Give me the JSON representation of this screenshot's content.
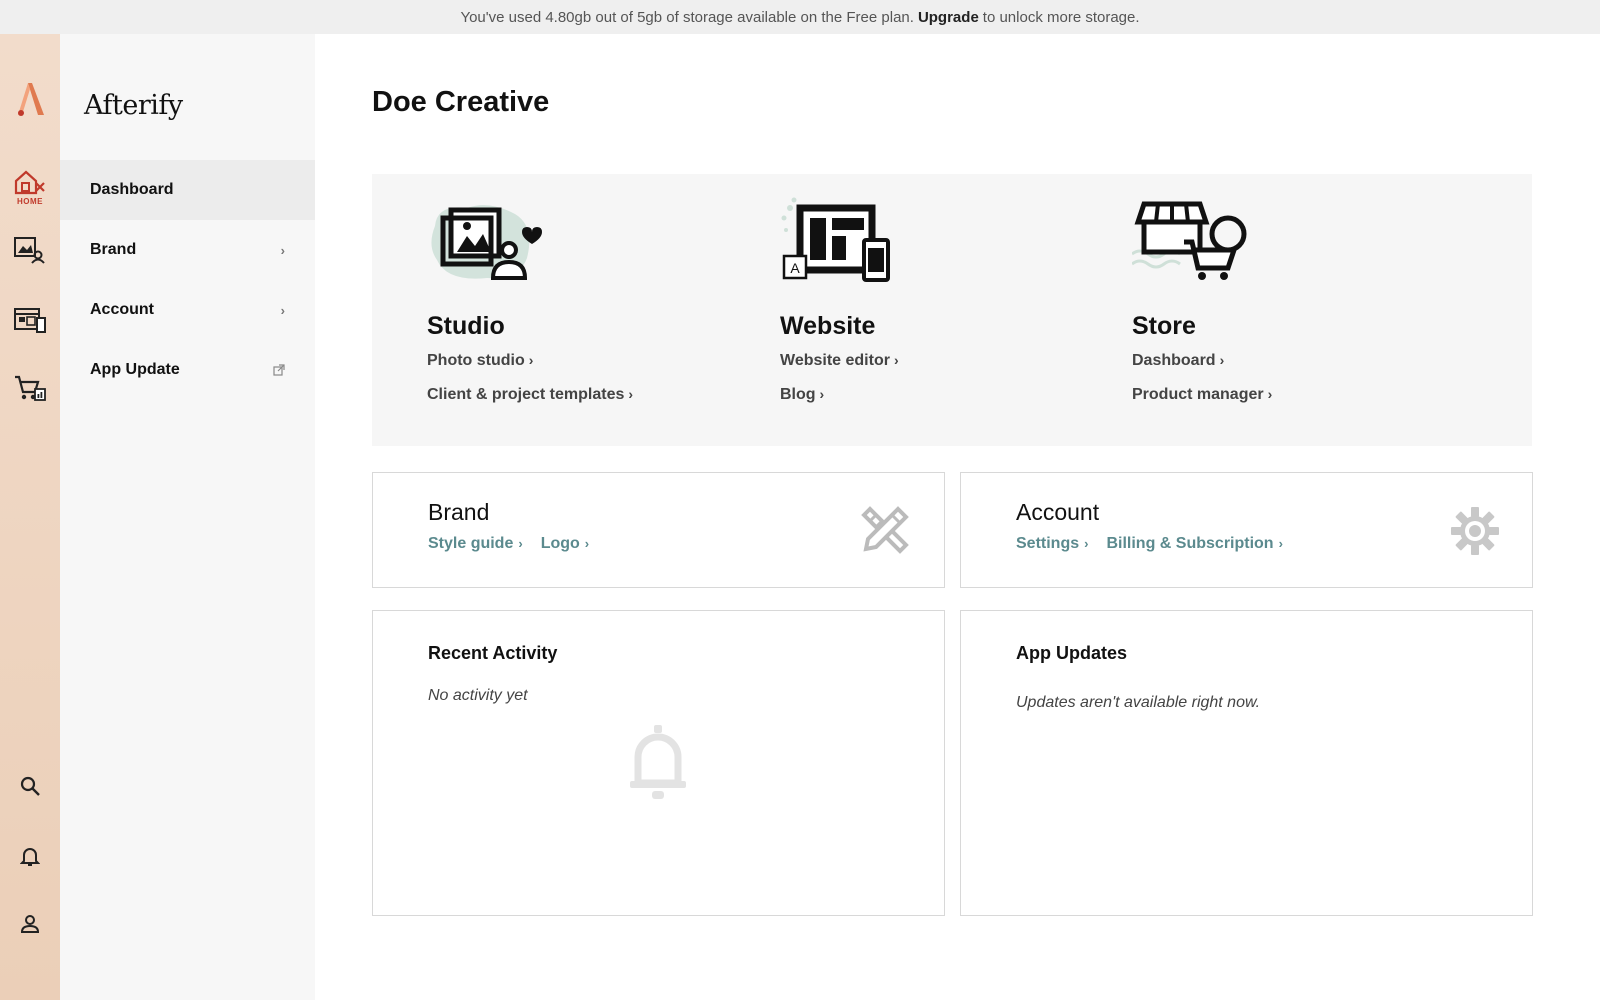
{
  "banner": {
    "prefix": "You've used 4.80gb out of 5gb of storage available on the Free plan.",
    "link": "Upgrade",
    "suffix": "to unlock more storage."
  },
  "rail": {
    "home_label": "HOME"
  },
  "sidebar": {
    "logo": "Afterify",
    "items": [
      {
        "label": "Dashboard",
        "active": true
      },
      {
        "label": "Brand"
      },
      {
        "label": "Account"
      },
      {
        "label": "App Update"
      }
    ]
  },
  "main": {
    "title": "Doe Creative",
    "hero": [
      {
        "title": "Studio",
        "links": [
          "Photo studio",
          "Client & project templates"
        ]
      },
      {
        "title": "Website",
        "links": [
          "Website editor",
          "Blog"
        ]
      },
      {
        "title": "Store",
        "links": [
          "Dashboard",
          "Product manager"
        ]
      }
    ],
    "brand_card": {
      "title": "Brand",
      "links": [
        "Style guide",
        "Logo"
      ]
    },
    "account_card": {
      "title": "Account",
      "links": [
        "Settings",
        "Billing & Subscription"
      ]
    },
    "recent_activity": {
      "title": "Recent Activity",
      "empty": "No activity yet"
    },
    "app_updates": {
      "title": "App Updates",
      "empty": "Updates aren't available right now."
    }
  },
  "colors": {
    "accent": "#5b8a8e",
    "home_red": "#c0392b",
    "logo_orange": "#e07a4f"
  }
}
